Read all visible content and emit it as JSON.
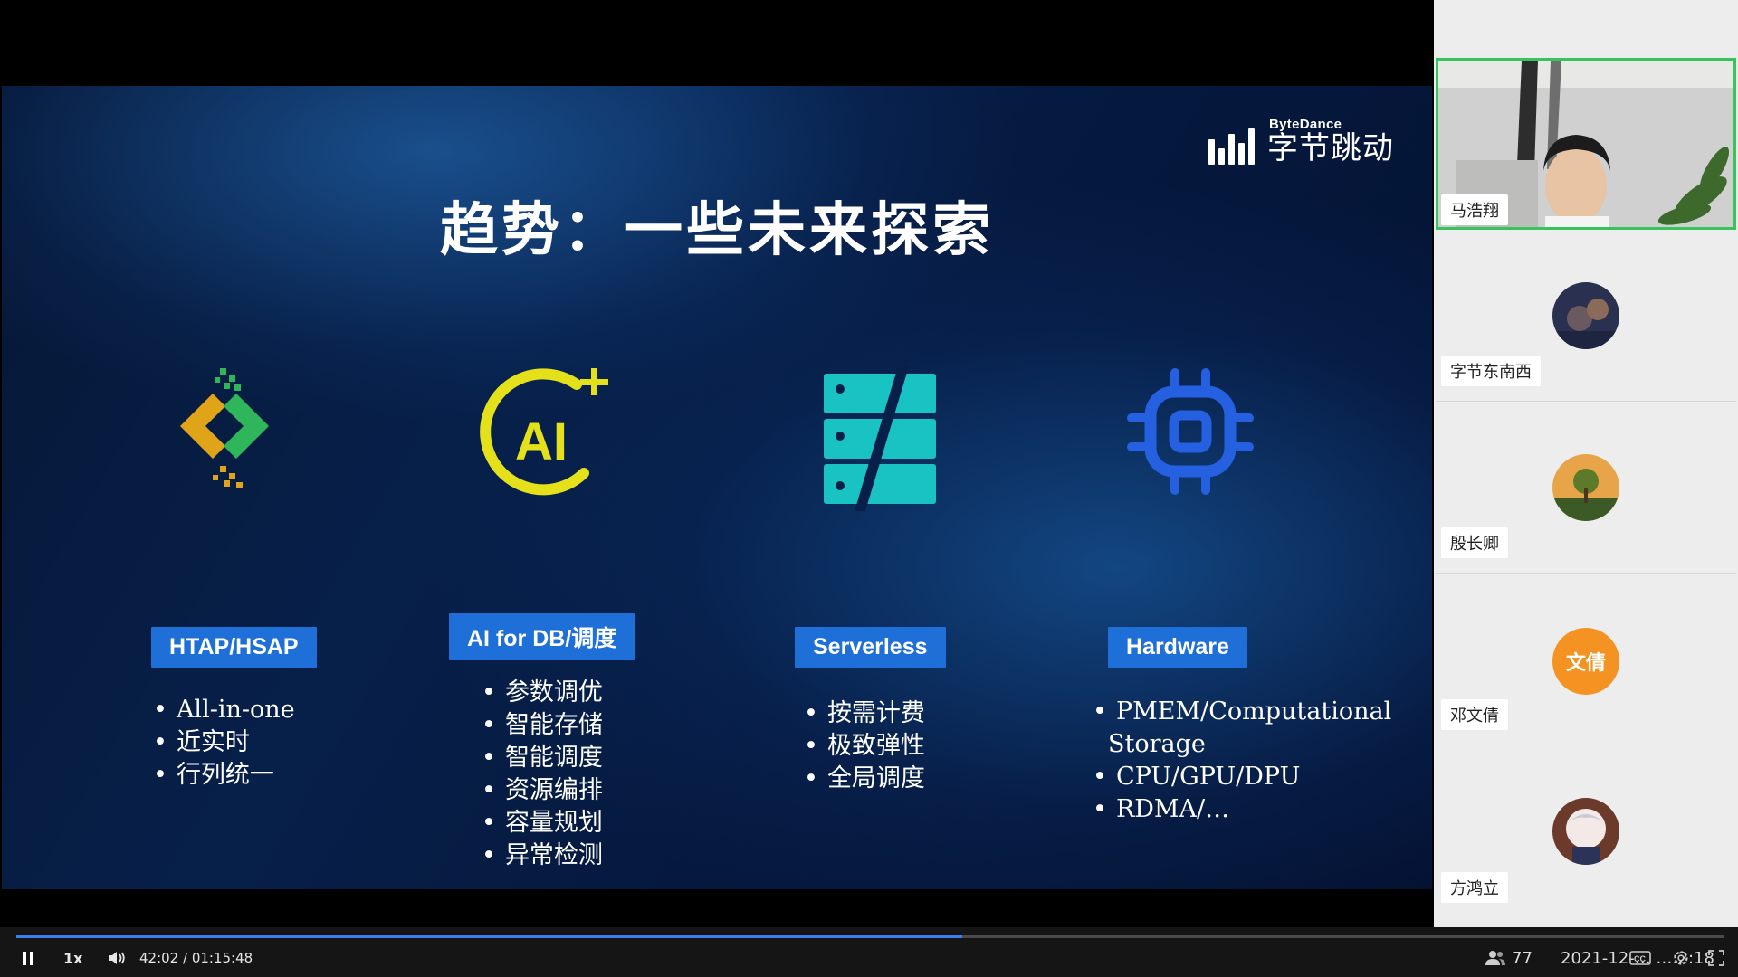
{
  "slide": {
    "title": "趋势：一些未来探索",
    "brand_en": "ByteDance",
    "brand_cn": "字节跳动",
    "columns": [
      {
        "label": "HTAP/HSAP",
        "icon": "htap-icon",
        "items": [
          "All-in-one",
          "近实时",
          "行列统一"
        ]
      },
      {
        "label": "AI for DB/调度",
        "icon": "ai-icon",
        "items": [
          "参数调优",
          "智能存储",
          "智能调度",
          "资源编排",
          "容量规划",
          "异常检测"
        ]
      },
      {
        "label": "Serverless",
        "icon": "server-icon",
        "items": [
          "按需计费",
          "极致弹性",
          "全局调度"
        ]
      },
      {
        "label": "Hardware",
        "icon": "chip-icon",
        "items": [
          "PMEM/Computational Storage",
          "CPU/GPU/DPU",
          "RDMA/…"
        ]
      }
    ],
    "colors": {
      "label_bg": "#1e6fd8",
      "ai_yellow": "#e4e11b",
      "server_teal": "#19c3c4",
      "chip_blue": "#2460e0"
    }
  },
  "participants": [
    {
      "name": "马浩翔",
      "type": "video"
    },
    {
      "name": "字节东南西",
      "type": "avatar-photo"
    },
    {
      "name": "殷长卿",
      "type": "avatar-photo"
    },
    {
      "name": "邓文倩",
      "type": "avatar-text",
      "avatar_text": "文倩",
      "avatar_color": "#f49322"
    },
    {
      "name": "方鸿立",
      "type": "avatar-photo"
    }
  ],
  "controls": {
    "speed": "1x",
    "time": "42:02 / 01:15:48",
    "progress": 0.554,
    "viewers": "77",
    "datetime": "2021-12-…   …:2:18"
  }
}
